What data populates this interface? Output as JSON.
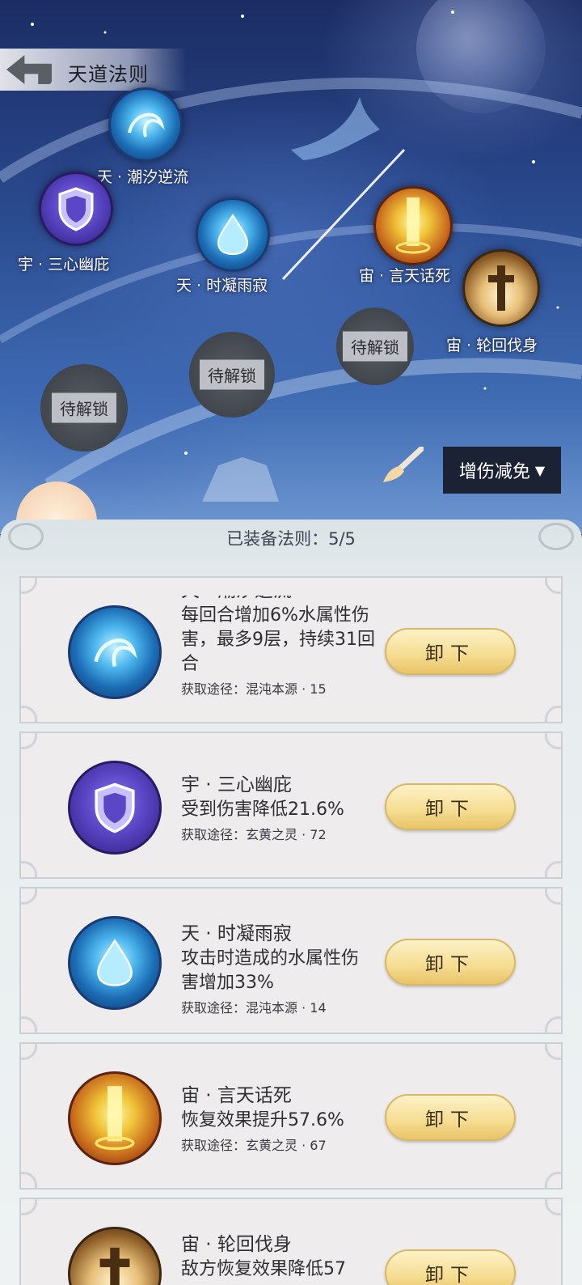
{
  "header": {
    "title": "天道法则"
  },
  "map": {
    "nodes": [
      {
        "id": "tide",
        "label": "天 · 潮汐逆流",
        "icon": "water-swirl-icon"
      },
      {
        "id": "heart",
        "label": "宇 · 三心幽庇",
        "icon": "shield-icon"
      },
      {
        "id": "rain",
        "label": "天 · 时凝雨寂",
        "icon": "water-drop-icon"
      },
      {
        "id": "word",
        "label": "宙 · 言天话死",
        "icon": "golden-pillar-icon"
      },
      {
        "id": "cycle",
        "label": "宙 · 轮回伐身",
        "icon": "cross-icon"
      }
    ],
    "locked_label": "待解锁",
    "filter": {
      "selected": "增伤减免"
    }
  },
  "panel": {
    "title": "已装备法则：5/5",
    "unload_label": "卸下",
    "cards": [
      {
        "name": "天 · 潮汐逆流",
        "desc": "每回合增加6%水属性伤害，最多9层，持续31回合",
        "source": "获取途径：混沌本源 · 15",
        "icon": "water-swirl-icon"
      },
      {
        "name": "宇 · 三心幽庇",
        "desc": "受到伤害降低21.6%",
        "source": "获取途径：玄黄之灵 · 72",
        "icon": "shield-icon"
      },
      {
        "name": "天 · 时凝雨寂",
        "desc": "攻击时造成的水属性伤害增加33%",
        "source": "获取途径：混沌本源 · 14",
        "icon": "water-drop-icon"
      },
      {
        "name": "宙 · 言天话死",
        "desc": "恢复效果提升57.6%",
        "source": "获取途径：玄黄之灵 · 67",
        "icon": "golden-pillar-icon"
      },
      {
        "name": "宙 · 轮回伐身",
        "desc": "敌方恢复效果降低57",
        "source": "",
        "icon": "cross-icon"
      }
    ]
  }
}
